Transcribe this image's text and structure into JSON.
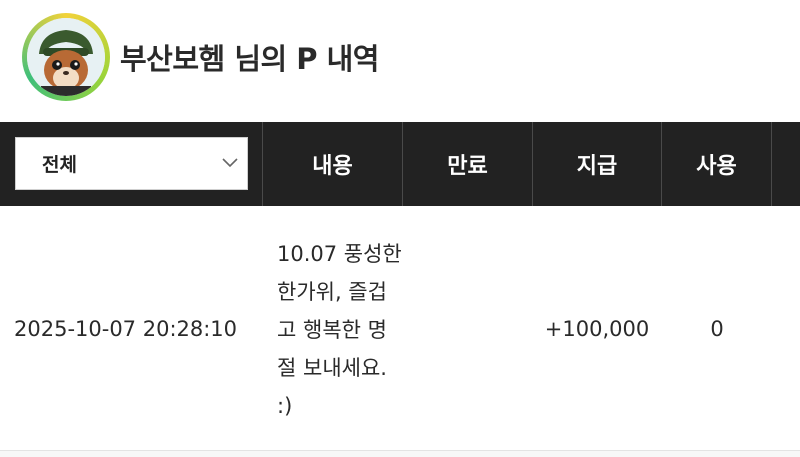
{
  "header": {
    "title": "부산보헴 님의 P 내역"
  },
  "table": {
    "filter_select": {
      "value": "전체"
    },
    "columns": [
      "내용",
      "만료",
      "지급",
      "사용"
    ],
    "rows": [
      {
        "datetime": "2025-10-07 20:28:10",
        "content": "10.07 풍성한 한가위, 즐겁고 행복한 명절 보내세요. :)",
        "expire": "",
        "give": "+100,000",
        "use": "0"
      }
    ]
  }
}
